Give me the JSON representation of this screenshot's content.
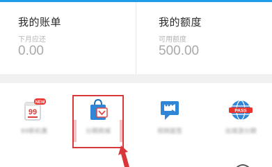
{
  "colors": {
    "accent": "#1e9be9",
    "highlight": "#d9383a"
  },
  "bill": {
    "title": "我的账单",
    "sub_label": "下月应还",
    "amount": "0.00"
  },
  "quota": {
    "title": "我的额度",
    "sub_label": "可用额度",
    "amount": "500.00"
  },
  "services": [
    {
      "icon": "calendar-99-new-icon",
      "badge": "NEW",
      "number": "99",
      "label": "99新机惠"
    },
    {
      "icon": "shopping-bag-icon",
      "label": "分期商城"
    },
    {
      "icon": "video-chat-icon",
      "label": "视频面签"
    },
    {
      "icon": "globe-pass-icon",
      "badge": "PASS",
      "label": "出境游分期"
    }
  ]
}
